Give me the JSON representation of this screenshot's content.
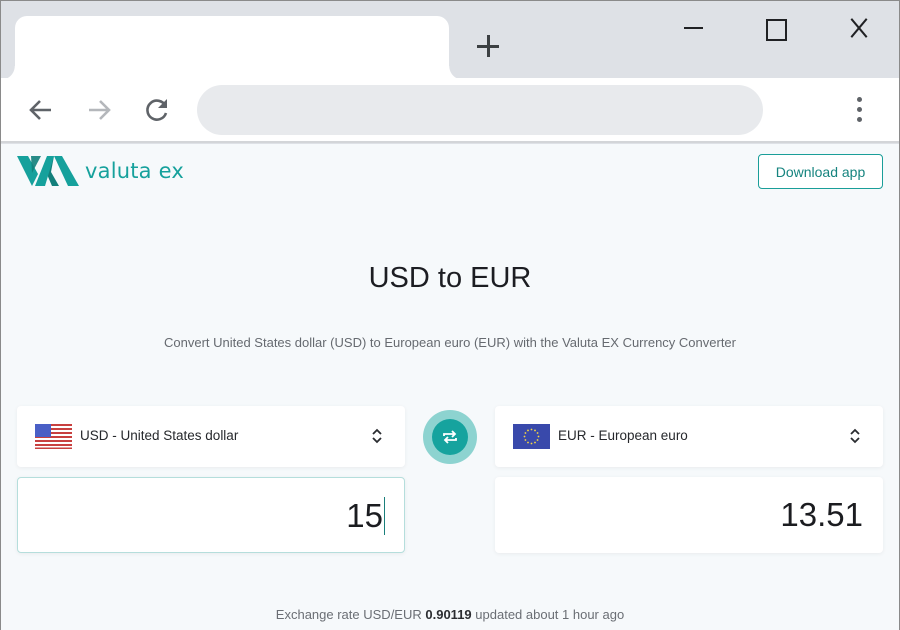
{
  "browser": {
    "new_tab_icon": "plus-icon",
    "window_controls": [
      "minimize-icon",
      "maximize-icon",
      "close-icon"
    ],
    "nav": {
      "back_icon": "arrow-left-icon",
      "forward_icon": "arrow-right-icon",
      "reload_icon": "reload-icon",
      "menu_icon": "kebab-menu-icon"
    },
    "address_bar": {
      "value": ""
    }
  },
  "header": {
    "logo_text": "valuta ex",
    "download_button": "Download app"
  },
  "main": {
    "title": "USD to EUR",
    "subtitle": "Convert United States dollar (USD) to European euro (EUR) with the Valuta EX Currency Converter"
  },
  "converter": {
    "from": {
      "flag": "us-flag-icon",
      "currency_label": "USD - United States dollar",
      "amount": "15"
    },
    "to": {
      "flag": "eu-flag-icon",
      "currency_label": "EUR - European euro",
      "amount": "13.51"
    },
    "swap_icon": "swap-arrows-icon"
  },
  "rate": {
    "prefix": "Exchange rate USD/EUR",
    "value": "0.90119",
    "suffix": "updated about 1 hour ago"
  },
  "colors": {
    "brand": "#16a19c",
    "swap_outer": "#8dd3d0",
    "page_bg": "#f6f9fb"
  }
}
